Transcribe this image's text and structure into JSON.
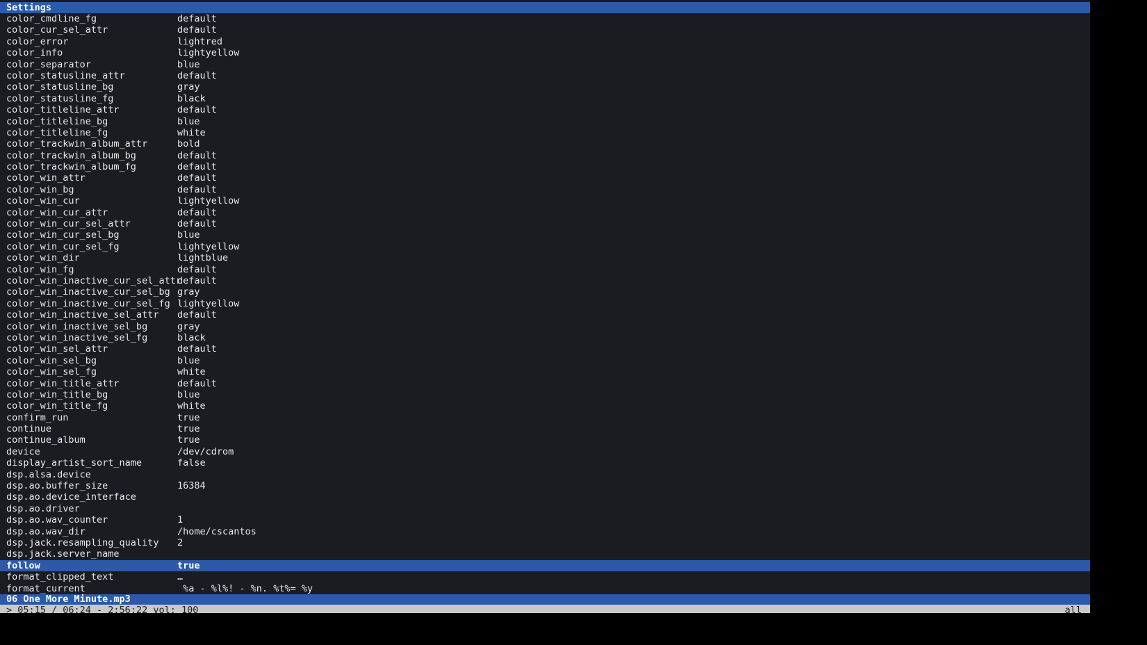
{
  "title": "Settings",
  "settings": [
    {
      "key": "color_cmdline_fg",
      "value": "default"
    },
    {
      "key": "color_cur_sel_attr",
      "value": "default"
    },
    {
      "key": "color_error",
      "value": "lightred"
    },
    {
      "key": "color_info",
      "value": "lightyellow"
    },
    {
      "key": "color_separator",
      "value": "blue"
    },
    {
      "key": "color_statusline_attr",
      "value": "default"
    },
    {
      "key": "color_statusline_bg",
      "value": "gray"
    },
    {
      "key": "color_statusline_fg",
      "value": "black"
    },
    {
      "key": "color_titleline_attr",
      "value": "default"
    },
    {
      "key": "color_titleline_bg",
      "value": "blue"
    },
    {
      "key": "color_titleline_fg",
      "value": "white"
    },
    {
      "key": "color_trackwin_album_attr",
      "value": "bold"
    },
    {
      "key": "color_trackwin_album_bg",
      "value": "default"
    },
    {
      "key": "color_trackwin_album_fg",
      "value": "default"
    },
    {
      "key": "color_win_attr",
      "value": "default"
    },
    {
      "key": "color_win_bg",
      "value": "default"
    },
    {
      "key": "color_win_cur",
      "value": "lightyellow"
    },
    {
      "key": "color_win_cur_attr",
      "value": "default"
    },
    {
      "key": "color_win_cur_sel_attr",
      "value": "default"
    },
    {
      "key": "color_win_cur_sel_bg",
      "value": "blue"
    },
    {
      "key": "color_win_cur_sel_fg",
      "value": "lightyellow"
    },
    {
      "key": "color_win_dir",
      "value": "lightblue"
    },
    {
      "key": "color_win_fg",
      "value": "default"
    },
    {
      "key": "color_win_inactive_cur_sel_attr",
      "value": "default"
    },
    {
      "key": "color_win_inactive_cur_sel_bg",
      "value": "gray"
    },
    {
      "key": "color_win_inactive_cur_sel_fg",
      "value": "lightyellow"
    },
    {
      "key": "color_win_inactive_sel_attr",
      "value": "default"
    },
    {
      "key": "color_win_inactive_sel_bg",
      "value": "gray"
    },
    {
      "key": "color_win_inactive_sel_fg",
      "value": "black"
    },
    {
      "key": "color_win_sel_attr",
      "value": "default"
    },
    {
      "key": "color_win_sel_bg",
      "value": "blue"
    },
    {
      "key": "color_win_sel_fg",
      "value": "white"
    },
    {
      "key": "color_win_title_attr",
      "value": "default"
    },
    {
      "key": "color_win_title_bg",
      "value": "blue"
    },
    {
      "key": "color_win_title_fg",
      "value": "white"
    },
    {
      "key": "confirm_run",
      "value": "true"
    },
    {
      "key": "continue",
      "value": "true"
    },
    {
      "key": "continue_album",
      "value": "true"
    },
    {
      "key": "device",
      "value": "/dev/cdrom"
    },
    {
      "key": "display_artist_sort_name",
      "value": "false"
    },
    {
      "key": "dsp.alsa.device",
      "value": ""
    },
    {
      "key": "dsp.ao.buffer_size",
      "value": "16384"
    },
    {
      "key": "dsp.ao.device_interface",
      "value": ""
    },
    {
      "key": "dsp.ao.driver",
      "value": ""
    },
    {
      "key": "dsp.ao.wav_counter",
      "value": "1"
    },
    {
      "key": "dsp.ao.wav_dir",
      "value": "/home/cscantos"
    },
    {
      "key": "dsp.jack.resampling_quality",
      "value": "2"
    },
    {
      "key": "dsp.jack.server_name",
      "value": ""
    },
    {
      "key": "follow",
      "value": "true",
      "selected": true
    },
    {
      "key": "format_clipped_text",
      "value": "…"
    },
    {
      "key": "format_current",
      "value": " %a - %l%! - %n. %t%= %y"
    }
  ],
  "status": {
    "track": "06 One More Minute.mp3",
    "player": "> 05:15 / 06:24 - 2:56:22 vol: 100",
    "filter": "all"
  },
  "colors": {
    "background": "#1b1b22",
    "titleline_bg": "#2d5aa8",
    "selection_bg": "#2d5aa8",
    "statusline_bg": "#c9c9c9",
    "text": "#e8e8e8"
  }
}
